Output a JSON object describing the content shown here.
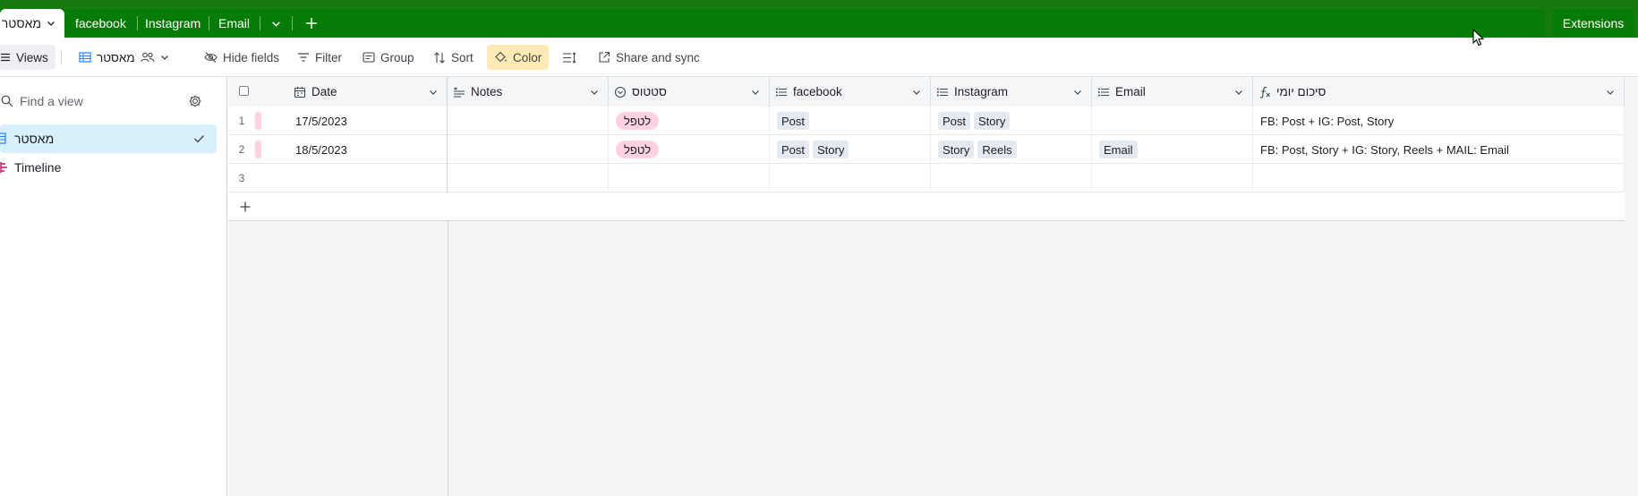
{
  "tabs": {
    "active": "מאסטר",
    "items": [
      "facebook",
      "Instagram",
      "Email"
    ],
    "extensions": "Extensions"
  },
  "toolbar": {
    "views": "Views",
    "view_name": "מאסטר",
    "hide_fields": "Hide fields",
    "filter": "Filter",
    "group": "Group",
    "sort": "Sort",
    "color": "Color",
    "share": "Share and sync"
  },
  "sidebar": {
    "search_placeholder": "Find a view",
    "views": [
      {
        "label": "מאסטר",
        "icon": "grid-view-icon",
        "active": true
      },
      {
        "label": "Timeline",
        "icon": "timeline-icon",
        "active": false
      }
    ]
  },
  "grid": {
    "columns": [
      {
        "label": "Date",
        "icon": "calendar-icon"
      },
      {
        "label": "Notes",
        "icon": "long-text-icon"
      },
      {
        "label": "סטטוס",
        "icon": "single-select-icon"
      },
      {
        "label": "facebook",
        "icon": "multi-select-icon"
      },
      {
        "label": "Instagram",
        "icon": "multi-select-icon"
      },
      {
        "label": "Email",
        "icon": "multi-select-icon"
      },
      {
        "label": "סיכום יומי",
        "icon": "formula-icon"
      }
    ],
    "rows": [
      {
        "num": "1",
        "date": "17/5/2023",
        "notes": "",
        "status": "לטפל",
        "facebook": [
          "Post"
        ],
        "instagram": [
          "Post",
          "Story"
        ],
        "email": [],
        "summary": "FB: Post + IG: Post, Story"
      },
      {
        "num": "2",
        "date": "18/5/2023",
        "notes": "",
        "status": "לטפל",
        "facebook": [
          "Post",
          "Story"
        ],
        "instagram": [
          "Story",
          "Reels"
        ],
        "email": [
          "Email"
        ],
        "summary": "FB: Post, Story + IG: Story, Reels + MAIL: Email"
      },
      {
        "num": "3",
        "date": "",
        "notes": "",
        "status": "",
        "facebook": [],
        "instagram": [],
        "email": [],
        "summary": ""
      }
    ]
  },
  "colors": {
    "topbar": "#067b05",
    "status_pill": "#ffd1e1",
    "chip": "#e4e9f2",
    "active_view": "#d8f0fb",
    "color_button": "#ffeab6"
  }
}
